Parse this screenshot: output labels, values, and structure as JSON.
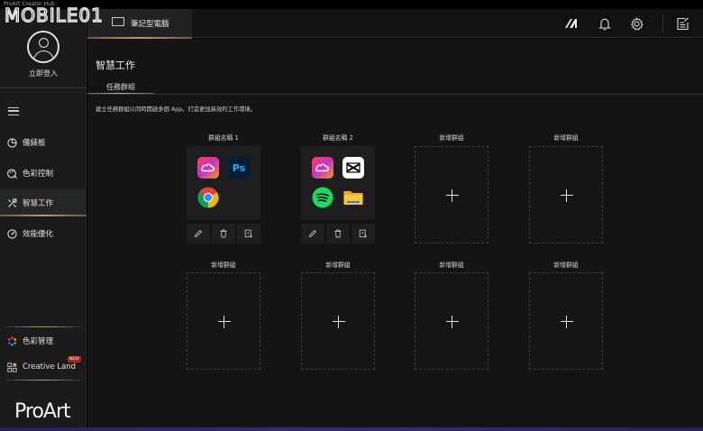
{
  "window": {
    "title": "ProArt Creator Hub"
  },
  "watermark": {
    "text": "MOBILE01"
  },
  "sidebar": {
    "login_label": "立即登入",
    "items": [
      {
        "label": "儀錶板",
        "icon": "dashboard-icon"
      },
      {
        "label": "色彩控制",
        "icon": "color-control-icon"
      },
      {
        "label": "智慧工作",
        "icon": "smart-work-icon",
        "active": true
      },
      {
        "label": "效能優化",
        "icon": "performance-icon"
      }
    ],
    "bottom_items": [
      {
        "label": "色彩管理",
        "icon": "color-wheel-icon"
      },
      {
        "label": "Creative Land",
        "icon": "creative-land-icon",
        "badge": "NEW"
      }
    ],
    "brand": "ProArt"
  },
  "topbar": {
    "device_tab": "筆記型電腦"
  },
  "main": {
    "title": "智慧工作",
    "subtab": "任務群組",
    "description": "建立任務群組以同時開啟多個 App。打造更加高效的工作環境。",
    "groups": [
      {
        "name": "群組名稱 1",
        "apps": [
          "creative-cloud",
          "photoshop",
          "chrome"
        ]
      },
      {
        "name": "群組名稱 2",
        "apps": [
          "creative-cloud",
          "capcut",
          "spotify",
          "file-explorer"
        ]
      }
    ],
    "add_label": "新增群組",
    "photoshop_text": "Ps"
  },
  "colors": {
    "accent_gold": "#b49b6d",
    "background": "#141414",
    "sidebar_bg": "#1b1b1c",
    "new_badge": "#c01a24"
  }
}
